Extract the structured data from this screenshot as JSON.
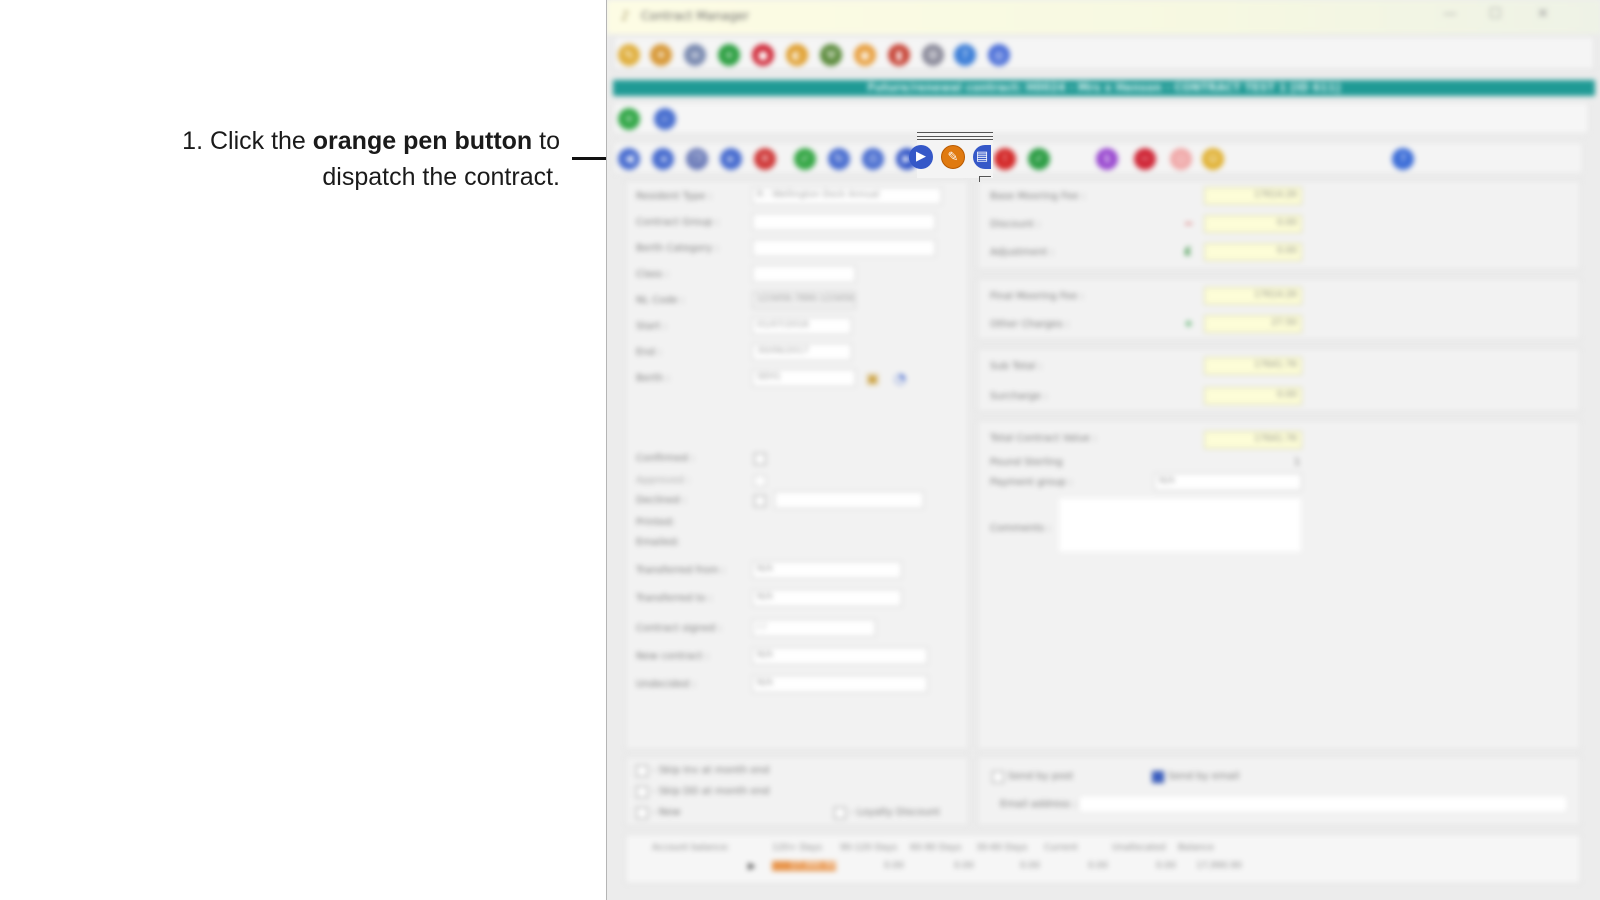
{
  "instruction": {
    "prefix": "1. Click the ",
    "emphasis": "orange pen button",
    "suffix": " to dispatch the contract."
  },
  "window": {
    "title": "Contract Manager",
    "banner": "Future/renewal contract: H0024 - Mrs x Henson - CONTRACT TEST 1 [ID 611]",
    "controls": {
      "minimize": "—",
      "maximize": "☐",
      "close": "✕"
    }
  },
  "toolbar": {
    "icons": [
      {
        "name": "edit-icon",
        "glyph": "✎",
        "color": "#e0b040"
      },
      {
        "name": "schedule-icon",
        "glyph": "✦",
        "color": "#d89a3a"
      },
      {
        "name": "ruler-icon",
        "glyph": "≡",
        "color": "#7a8ab0"
      },
      {
        "name": "add-icon",
        "glyph": "+",
        "color": "#2ea043"
      },
      {
        "name": "stop-icon",
        "glyph": "●",
        "color": "#d02838"
      },
      {
        "name": "globe-icon",
        "glyph": "◐",
        "color": "#e0a030"
      },
      {
        "name": "tools-icon",
        "glyph": "⚒",
        "color": "#5a8a3a"
      },
      {
        "name": "coins-icon",
        "glyph": "◉",
        "color": "#e8a040"
      },
      {
        "name": "chart-icon",
        "glyph": "▮",
        "color": "#c8473a"
      },
      {
        "name": "settings-icon",
        "glyph": "⚙",
        "color": "#8a8a9a"
      },
      {
        "name": "help-icon",
        "glyph": "?",
        "color": "#3d7fd8"
      },
      {
        "name": "info-icon",
        "glyph": "◎",
        "color": "#4a6ed8"
      }
    ]
  },
  "subbar": {
    "icons": [
      {
        "name": "new-icon",
        "glyph": "+",
        "color": "#35a84a"
      },
      {
        "name": "search-icon",
        "glyph": "⌕",
        "color": "#4a70d0"
      }
    ]
  },
  "actions": {
    "icons": [
      {
        "name": "first-icon",
        "glyph": "◀",
        "color": "#4a6ed0"
      },
      {
        "name": "prev-icon",
        "glyph": "◂",
        "color": "#4a6ed0"
      },
      {
        "name": "copy-icon",
        "glyph": "❐",
        "color": "#6a7ab8"
      },
      {
        "name": "next-icon",
        "glyph": "▸",
        "color": "#4a6ed0"
      },
      {
        "name": "delete-icon",
        "glyph": "✕",
        "color": "#d03a3a"
      },
      {
        "name": "confirm-icon",
        "glyph": "✓",
        "color": "#38a848"
      },
      {
        "name": "refresh-icon",
        "glyph": "↻",
        "color": "#4a6ed0"
      },
      {
        "name": "print-icon",
        "glyph": "⎙",
        "color": "#4a6ed0"
      },
      {
        "name": "send-icon",
        "glyph": "▶",
        "color": "#3558c8"
      },
      {
        "name": "pen-icon",
        "glyph": "✎",
        "color": "#e07a10"
      },
      {
        "name": "document-icon",
        "glyph": "▤",
        "color": "#3558c8"
      },
      {
        "name": "alert-icon",
        "glyph": "!",
        "color": "#d42a2a"
      },
      {
        "name": "approve-icon",
        "glyph": "✓",
        "color": "#2e9e46"
      },
      {
        "name": "money-icon",
        "glyph": "$",
        "color": "#9a4ad0"
      },
      {
        "name": "cancel-icon",
        "glyph": "−",
        "color": "#d02838"
      },
      {
        "name": "disabled-icon",
        "glyph": "○",
        "color": "#f0a8a8"
      },
      {
        "name": "smile-icon",
        "glyph": "☺",
        "color": "#e0b030"
      },
      {
        "name": "action-help-icon",
        "glyph": "?",
        "color": "#3d6ed8"
      }
    ]
  },
  "form": {
    "resident_type": {
      "label": "Resident Type :",
      "value": "R - Wellington Dock Annual"
    },
    "contract_group": {
      "label": "Contract Group :",
      "value": ""
    },
    "berth_category": {
      "label": "Berth Category :",
      "value": ""
    },
    "class": {
      "label": "Class :",
      "value": ""
    },
    "nl_code": {
      "label": "NL Code :",
      "value": "123456.7890.123456"
    },
    "start": {
      "label": "Start :",
      "value": "01/07/2016"
    },
    "end": {
      "label": "End :",
      "value": "30/06/2017"
    },
    "berth": {
      "label": "Berth :",
      "value": "SEH1"
    },
    "confirmed": {
      "label": "Confirmed :"
    },
    "approved": {
      "label": "Approved :"
    },
    "declined": {
      "label": "Declined :",
      "value": ""
    },
    "printed": {
      "label": "Printed:"
    },
    "emailed": {
      "label": "Emailed:"
    },
    "transferred_from": {
      "label": "Transferred from :",
      "value": "N/A"
    },
    "transferred_to": {
      "label": "Transferred to :",
      "value": "N/A"
    },
    "contract_signed": {
      "label": "Contract signed :",
      "value": " / /"
    },
    "new_contract": {
      "label": "New contract :",
      "value": "N/A"
    },
    "undecided": {
      "label": "Undecided :",
      "value": "N/A"
    }
  },
  "fees": {
    "base_mooring_fee": {
      "label": "Base Mooring Fee :",
      "value": "17614.26"
    },
    "discount": {
      "label": "Discount :",
      "value": "0.00"
    },
    "adjustment": {
      "label": "Adjustment :",
      "value": "0.00"
    },
    "final_mooring_fee": {
      "label": "Final Mooring Fee :",
      "value": "17614.26"
    },
    "other_charges": {
      "label": "Other Charges :",
      "value": "27.50"
    },
    "sub_total": {
      "label": "Sub Total :",
      "value": "17641.76"
    },
    "surcharge": {
      "label": "Surcharge :",
      "value": "0.00"
    },
    "total_contract_value": {
      "label": "Total Contract Value :",
      "value": "17641.76"
    },
    "currency": {
      "label": "Pound Sterling",
      "value": "1"
    },
    "payment_group": {
      "label": "Payment group :",
      "value": "N/A"
    },
    "comments": {
      "label": "Comments :",
      "value": ""
    }
  },
  "options": {
    "skip_inv": "- Skip Inv at month end",
    "skip_dd": "- Skip DD at month end",
    "new": "- New",
    "loyalty": "- Loyalty Discount",
    "send_by_post": "Send by post",
    "send_by_email": "Send by email",
    "email_address_label": "Email address :"
  },
  "balance": {
    "label": "Account balance:",
    "headers": [
      "120+ Days",
      "90-120 Days",
      "60-90 Days",
      "30-60 Days",
      "Current",
      "Unallocated",
      "Balance"
    ],
    "values": [
      "17,990.90",
      "0.00",
      "0.00",
      "0.00",
      "0.00",
      "0.00",
      "17,990.90"
    ]
  },
  "colors": {
    "banner": "#1f9a95",
    "fee_field": "#fdfdd7",
    "pen_button": "#e07a10",
    "overdue_cell": "#e8944a"
  }
}
